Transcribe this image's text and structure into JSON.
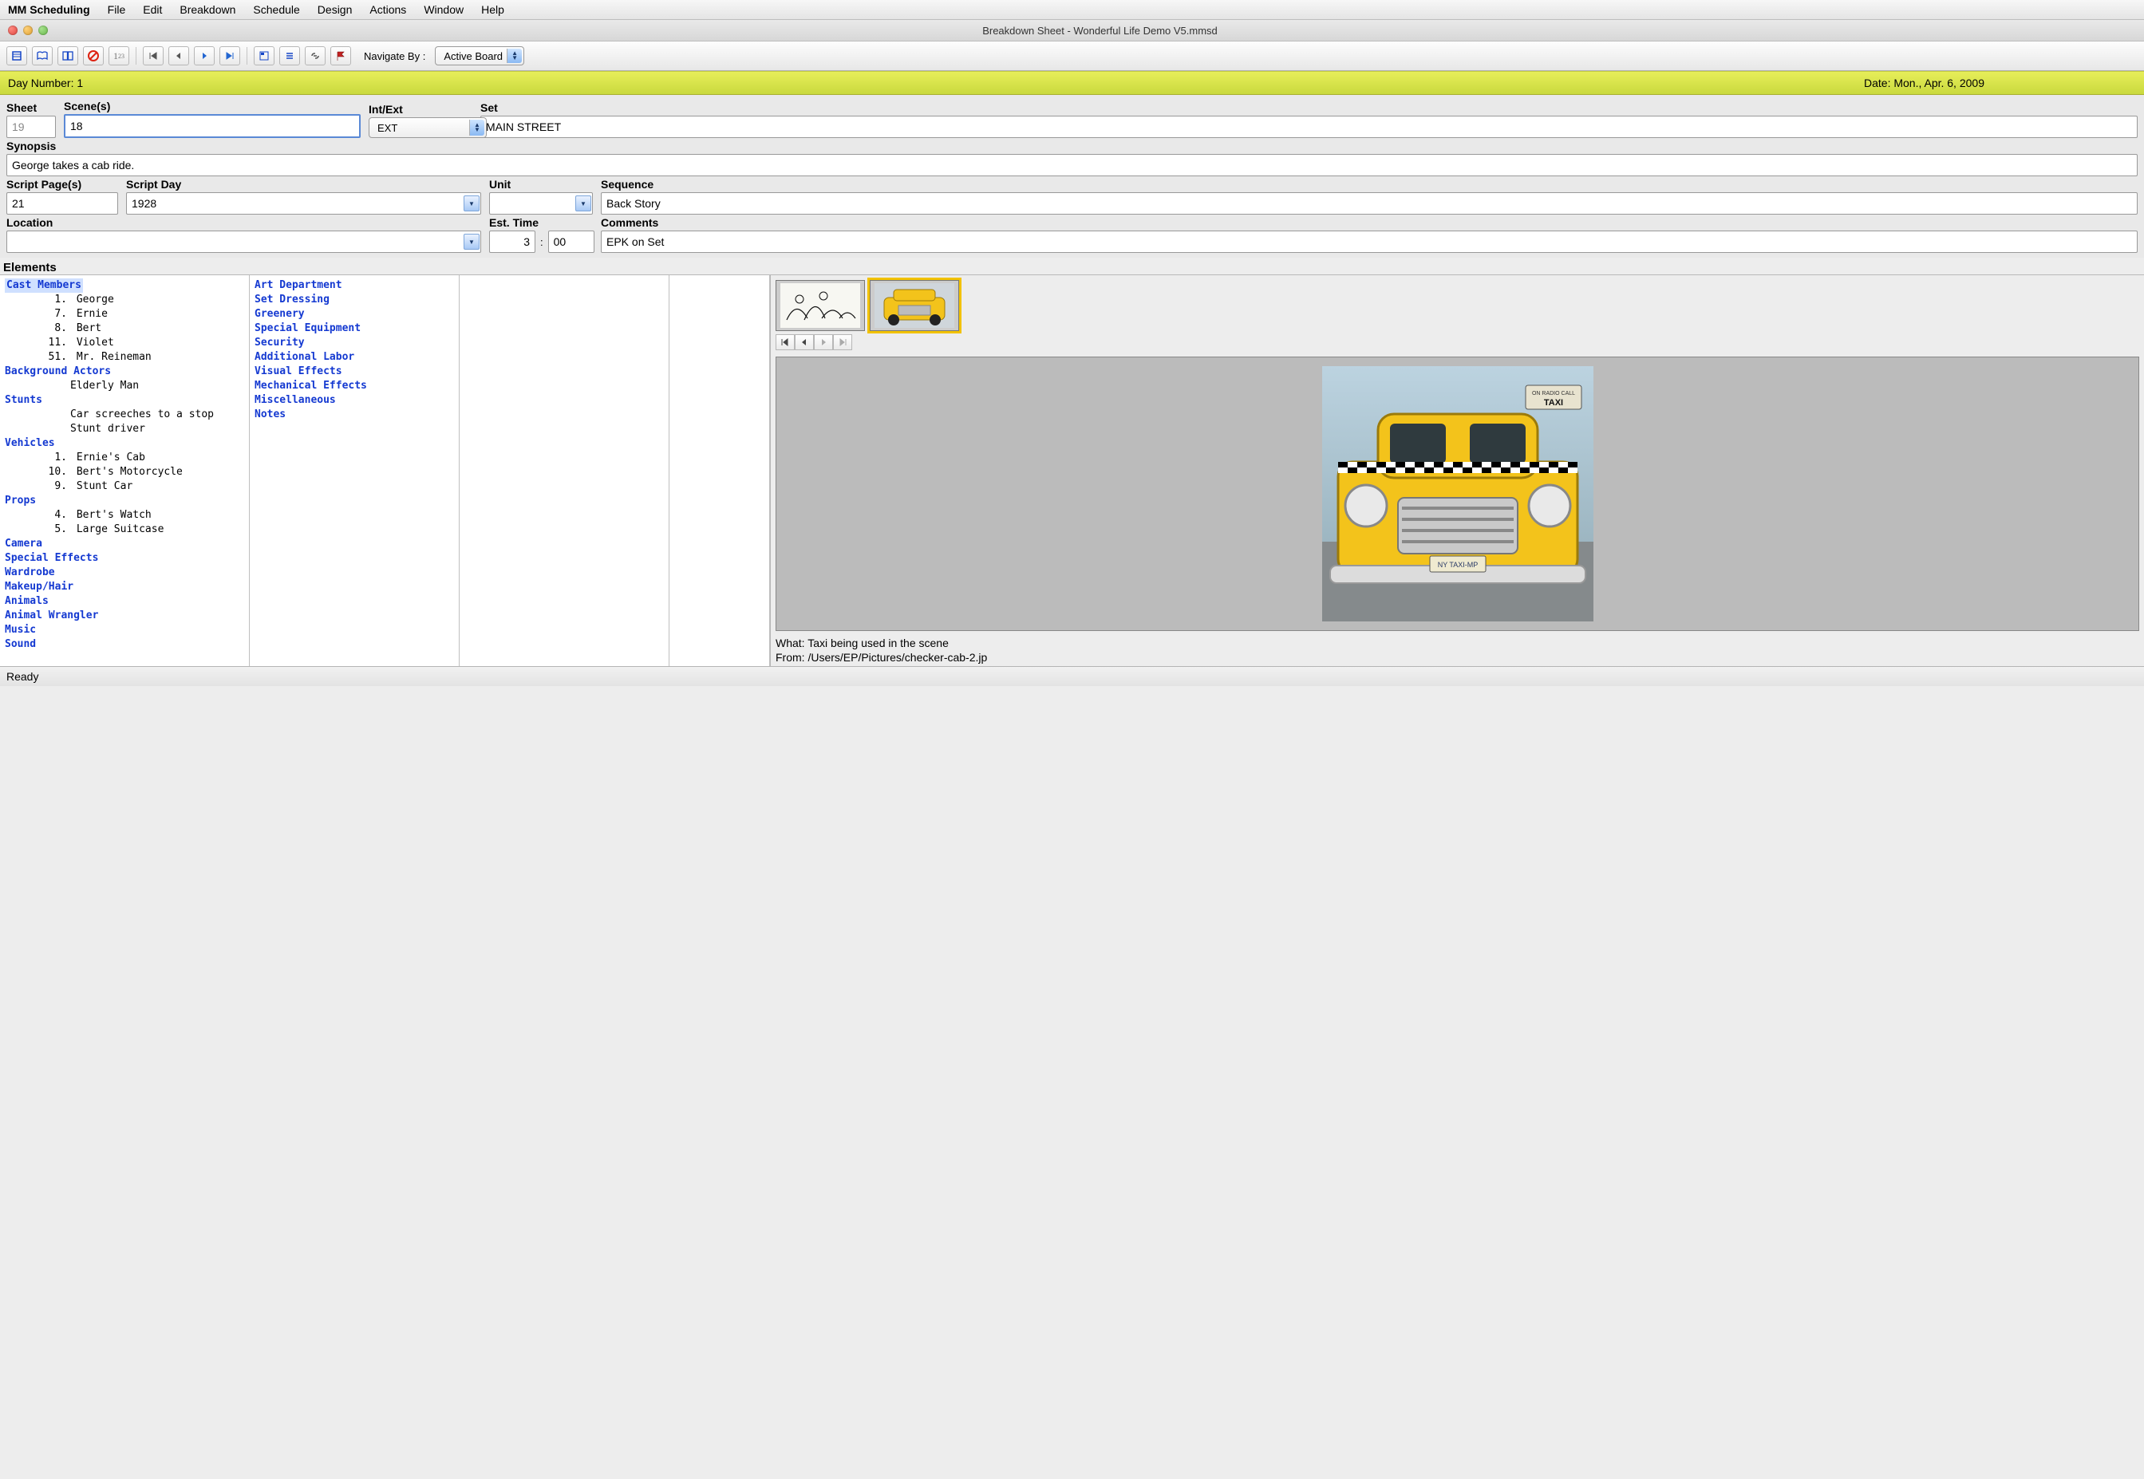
{
  "menu": {
    "app": "MM Scheduling",
    "items": [
      "File",
      "Edit",
      "Breakdown",
      "Schedule",
      "Design",
      "Actions",
      "Window",
      "Help"
    ]
  },
  "window": {
    "title": "Breakdown Sheet - Wonderful Life Demo V5.mmsd"
  },
  "toolbar": {
    "navigate_by_label": "Navigate By :",
    "navigate_by_value": "Active Board"
  },
  "daybar": {
    "day_label": "Day Number: 1",
    "date_label": "Date: Mon., Apr. 6, 2009"
  },
  "form": {
    "sheet": {
      "label": "Sheet",
      "value": "19"
    },
    "scenes": {
      "label": "Scene(s)",
      "value": "18"
    },
    "intext": {
      "label": "Int/Ext",
      "value": "EXT"
    },
    "set": {
      "label": "Set",
      "value": "MAIN STREET"
    },
    "synopsis": {
      "label": "Synopsis",
      "value": "George takes a cab ride."
    },
    "script_pages": {
      "label": "Script Page(s)",
      "value": "21"
    },
    "script_day": {
      "label": "Script Day",
      "value": "1928"
    },
    "unit": {
      "label": "Unit",
      "value": ""
    },
    "sequence": {
      "label": "Sequence",
      "value": "Back Story"
    },
    "location": {
      "label": "Location",
      "value": ""
    },
    "est_time": {
      "label": "Est. Time",
      "hours": "3",
      "minutes": "00"
    },
    "comments": {
      "label": "Comments",
      "value": "EPK on Set"
    },
    "elements_label": "Elements"
  },
  "elements": {
    "col1": [
      {
        "cat": "Cast Members",
        "selected": true,
        "items": [
          {
            "num": "1.",
            "name": "George"
          },
          {
            "num": "7.",
            "name": "Ernie"
          },
          {
            "num": "8.",
            "name": "Bert"
          },
          {
            "num": "11.",
            "name": "Violet"
          },
          {
            "num": "51.",
            "name": "Mr. Reineman"
          }
        ]
      },
      {
        "cat": "Background Actors",
        "items": [
          {
            "name": "Elderly Man"
          }
        ]
      },
      {
        "cat": "Stunts",
        "items": [
          {
            "name": "Car screeches to a stop"
          },
          {
            "name": "Stunt driver"
          }
        ]
      },
      {
        "cat": "Vehicles",
        "items": [
          {
            "num": "1.",
            "name": "Ernie's Cab"
          },
          {
            "num": "10.",
            "name": "Bert's Motorcycle"
          },
          {
            "num": "9.",
            "name": "Stunt Car"
          }
        ]
      },
      {
        "cat": "Props",
        "items": [
          {
            "num": "4.",
            "name": "Bert's Watch"
          },
          {
            "num": "5.",
            "name": "Large Suitcase"
          }
        ]
      },
      {
        "cat": "Camera",
        "items": []
      },
      {
        "cat": "Special Effects",
        "items": []
      },
      {
        "cat": "Wardrobe",
        "items": []
      },
      {
        "cat": "Makeup/Hair",
        "items": []
      },
      {
        "cat": "Animals",
        "items": []
      },
      {
        "cat": "Animal Wrangler",
        "items": []
      },
      {
        "cat": "Music",
        "items": []
      },
      {
        "cat": "Sound",
        "items": []
      }
    ],
    "col2": [
      {
        "cat": "Art Department"
      },
      {
        "cat": "Set Dressing"
      },
      {
        "cat": "Greenery"
      },
      {
        "cat": "Special Equipment"
      },
      {
        "cat": "Security"
      },
      {
        "cat": "Additional Labor"
      },
      {
        "cat": "Visual Effects"
      },
      {
        "cat": "Mechanical Effects"
      },
      {
        "cat": "Miscellaneous"
      },
      {
        "cat": "Notes"
      }
    ]
  },
  "image": {
    "thumb1_alt": "storyboard-sketch",
    "thumb2_alt": "yellow-taxi-photo",
    "caption_what": "What:  Taxi being used in the scene",
    "caption_from": "From:  /Users/EP/Pictures/checker-cab-2.jp"
  },
  "status": {
    "text": "Ready"
  }
}
